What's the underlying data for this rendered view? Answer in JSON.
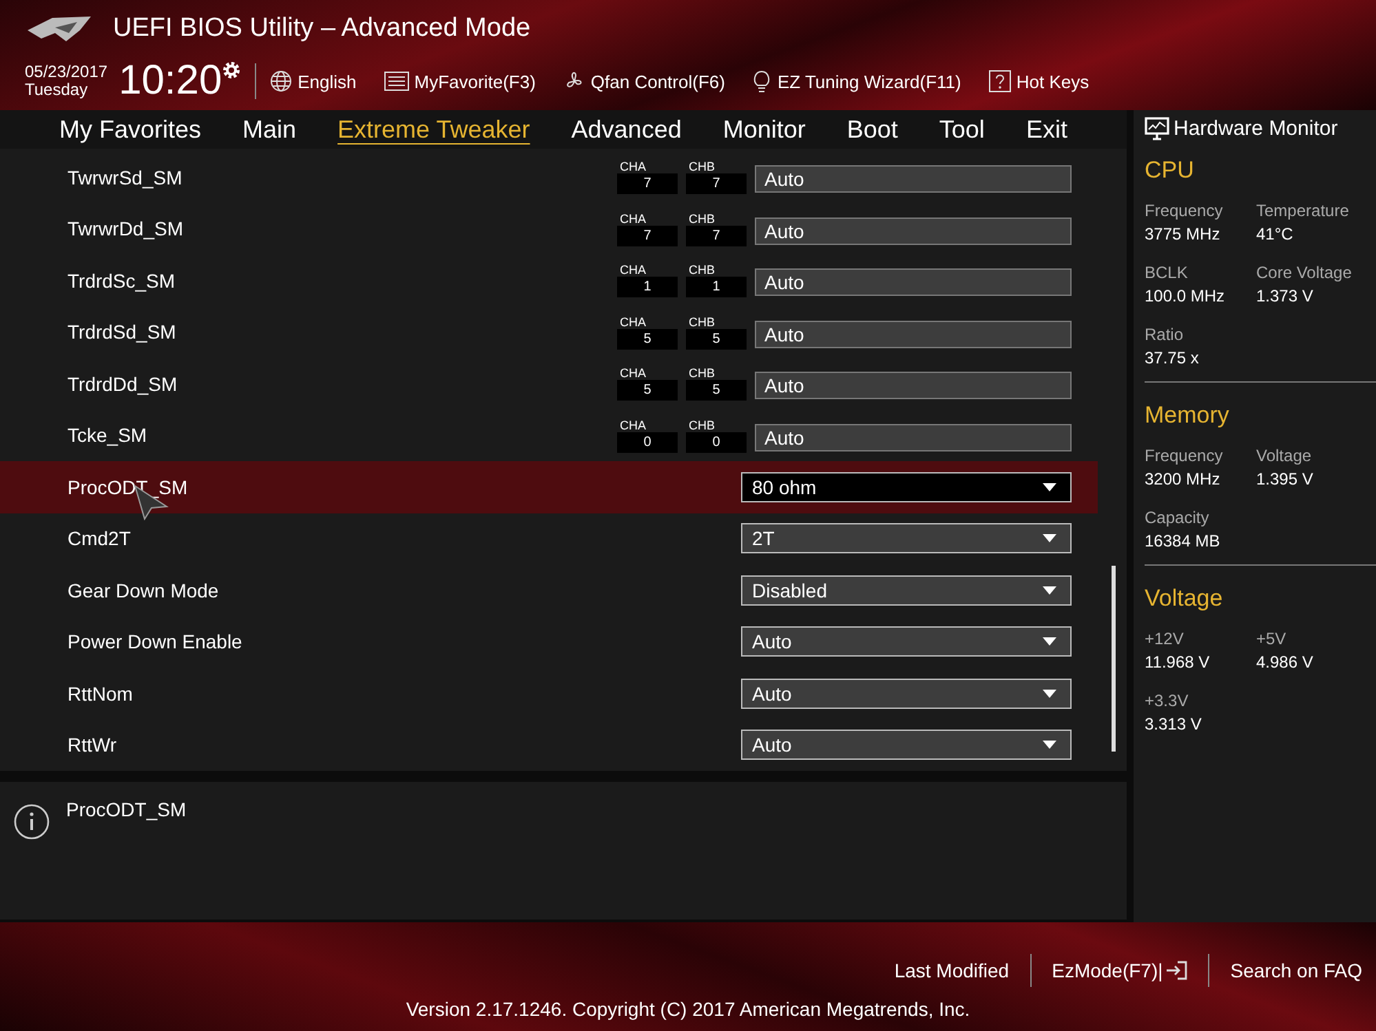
{
  "title": "UEFI BIOS Utility – Advanced Mode",
  "clock": {
    "date": "05/23/2017",
    "day": "Tuesday",
    "time": "10:20"
  },
  "toolbar": [
    {
      "label": "English",
      "kind": "globe"
    },
    {
      "label": "MyFavorite(F3)",
      "kind": "list"
    },
    {
      "label": "Qfan Control(F6)",
      "kind": "fan"
    },
    {
      "label": "EZ Tuning Wizard(F11)",
      "kind": "bulb"
    },
    {
      "label": "Hot Keys",
      "kind": "help"
    }
  ],
  "tabs": [
    {
      "label": "My Favorites",
      "selected": false
    },
    {
      "label": "Main",
      "selected": false
    },
    {
      "label": "Extreme Tweaker",
      "selected": true
    },
    {
      "label": "Advanced",
      "selected": false
    },
    {
      "label": "Monitor",
      "selected": false
    },
    {
      "label": "Boot",
      "selected": false
    },
    {
      "label": "Tool",
      "selected": false
    },
    {
      "label": "Exit",
      "selected": false
    }
  ],
  "settings": [
    {
      "name": "TwrwrSd_SM",
      "kind": "channels",
      "cha": "7",
      "chb": "7",
      "channel_labels": [
        "CHA",
        "CHB"
      ],
      "value": "Auto",
      "selected": false
    },
    {
      "name": "TwrwrDd_SM",
      "kind": "channels",
      "cha": "7",
      "chb": "7",
      "channel_labels": [
        "CHA",
        "CHB"
      ],
      "value": "Auto",
      "selected": false
    },
    {
      "name": "TrdrdSc_SM",
      "kind": "channels",
      "cha": "1",
      "chb": "1",
      "channel_labels": [
        "CHA",
        "CHB"
      ],
      "value": "Auto",
      "selected": false
    },
    {
      "name": "TrdrdSd_SM",
      "kind": "channels",
      "cha": "5",
      "chb": "5",
      "channel_labels": [
        "CHA",
        "CHB"
      ],
      "value": "Auto",
      "selected": false
    },
    {
      "name": "TrdrdDd_SM",
      "kind": "channels",
      "cha": "5",
      "chb": "5",
      "channel_labels": [
        "CHA",
        "CHB"
      ],
      "value": "Auto",
      "selected": false
    },
    {
      "name": "Tcke_SM",
      "kind": "channels",
      "cha": "0",
      "chb": "0",
      "channel_labels": [
        "CHA",
        "CHB"
      ],
      "value": "Auto",
      "selected": false
    },
    {
      "name": "ProcODT_SM",
      "kind": "dropdown",
      "value": "80 ohm",
      "selected": true
    },
    {
      "name": "Cmd2T",
      "kind": "dropdown",
      "value": "2T",
      "selected": false
    },
    {
      "name": "Gear Down Mode",
      "kind": "dropdown",
      "value": "Disabled",
      "selected": false
    },
    {
      "name": "Power Down Enable",
      "kind": "dropdown",
      "value": "Auto",
      "selected": false
    },
    {
      "name": "RttNom",
      "kind": "dropdown",
      "value": "Auto",
      "selected": false
    },
    {
      "name": "RttWr",
      "kind": "dropdown",
      "value": "Auto",
      "selected": false
    }
  ],
  "help": {
    "text": "ProcODT_SM"
  },
  "hardware_monitor": {
    "title": "Hardware Monitor",
    "sections": [
      {
        "title": "CPU",
        "items": [
          {
            "label": "Frequency",
            "value": "3775 MHz"
          },
          {
            "label": "Temperature",
            "value": "41°C"
          },
          {
            "label": "BCLK",
            "value": "100.0 MHz"
          },
          {
            "label": "Core Voltage",
            "value": "1.373 V"
          },
          {
            "label": "Ratio",
            "value": "37.75 x"
          }
        ]
      },
      {
        "title": "Memory",
        "items": [
          {
            "label": "Frequency",
            "value": "3200 MHz"
          },
          {
            "label": "Voltage",
            "value": "1.395 V"
          },
          {
            "label": "Capacity",
            "value": "16384 MB"
          }
        ]
      },
      {
        "title": "Voltage",
        "items": [
          {
            "label": "+12V",
            "value": "11.968 V"
          },
          {
            "label": "+5V",
            "value": "4.986 V"
          },
          {
            "label": "+3.3V",
            "value": "3.313 V"
          }
        ]
      }
    ]
  },
  "footer": {
    "links": [
      {
        "label": "Last Modified",
        "kind": "text"
      },
      {
        "label": "EzMode(F7)|",
        "kind": "exit"
      },
      {
        "label": "Search on FAQ",
        "kind": "text"
      }
    ],
    "version": "Version 2.17.1246. Copyright (C) 2017 American Megatrends, Inc."
  }
}
